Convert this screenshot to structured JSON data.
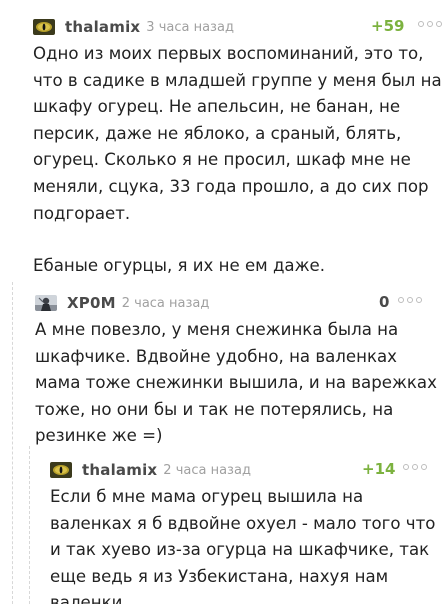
{
  "comments": [
    {
      "username": "thalamix",
      "time": "3 часа назад",
      "rating": "+59",
      "avatar_icon": "cat-eye-avatar",
      "paragraphs": [
        "Одно из моих первых воспоминаний, это то, что в садике в младшей группе у меня был на шкафу огурец. Не апельсин, не банан, не персик, даже не яблоко, а сраный, блять, огурец. Сколько я не просил, шкаф мне не меняли, сцука, 33 года прошло, а до сих пор подгорает.",
        "Ебаные огурцы, я их не ем даже."
      ]
    },
    {
      "username": "XP0M",
      "time": "2 часа назад",
      "rating": "0",
      "avatar_icon": "character-avatar",
      "paragraphs": [
        "А мне повезло, у меня снежинка была на шкафчике. Вдвойне удобно, на валенках мама тоже снежинки вышила, и на варежках тоже, но они бы и так не потерялись, на резинке же =)"
      ]
    },
    {
      "username": "thalamix",
      "time": "2 часа назад",
      "rating": "+14",
      "avatar_icon": "cat-eye-avatar",
      "paragraphs": [
        "Если б мне мама огурец вышила на валенках я б вдвойне охуел - мало того что и так хуево из-за огурца на шкафчике, так еще ведь я из Узбекистана, нахуя нам валенки."
      ]
    }
  ],
  "colors": {
    "positive_rating": "#7cb23f",
    "neutral_rating": "#4a4a4a",
    "username": "#4a4a4a",
    "time": "#a0a0a0",
    "text": "#222222"
  }
}
